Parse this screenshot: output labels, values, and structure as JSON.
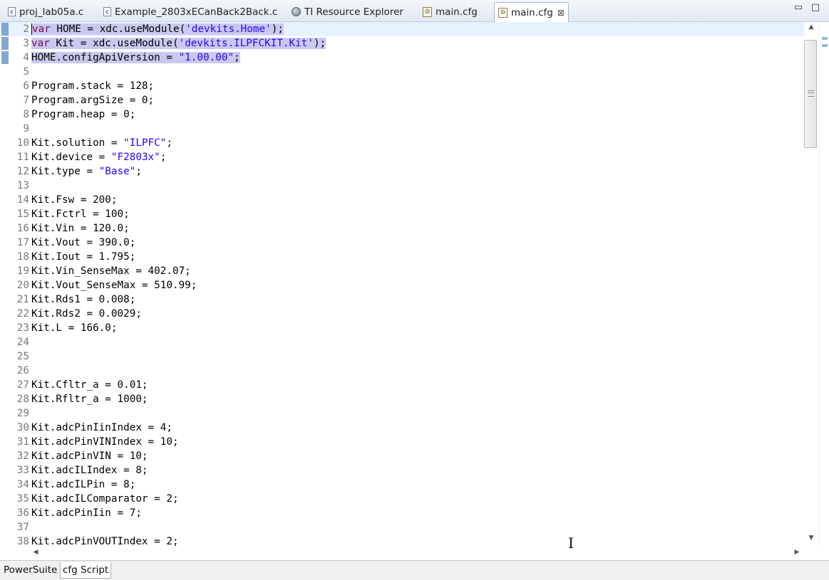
{
  "tabs": [
    {
      "label": "proj_lab05a.c",
      "icon": "c-file-icon"
    },
    {
      "label": "Example_2803xECanBack2Back.c",
      "icon": "c-file-icon"
    },
    {
      "label": "TI Resource Explorer",
      "icon": "globe-icon"
    },
    {
      "label": "main.cfg",
      "icon": "cfg-file-icon"
    },
    {
      "label": "main.cfg",
      "icon": "cfg-file-icon",
      "active": true,
      "close": "⊠"
    }
  ],
  "window_controls": {
    "minimize": "▭",
    "maximize": "□"
  },
  "code_lines": [
    {
      "n": "2",
      "parts": [
        [
          "kw",
          "var"
        ],
        [
          "t",
          " HOME = xdc.useModule("
        ],
        [
          "str",
          "'devkits.Home'"
        ],
        [
          "t",
          ");"
        ]
      ]
    },
    {
      "n": "3",
      "parts": [
        [
          "kw",
          "var"
        ],
        [
          "t",
          " Kit = xdc.useModule("
        ],
        [
          "str",
          "'devkits.ILPFCKIT.Kit'"
        ],
        [
          "t",
          ");"
        ]
      ]
    },
    {
      "n": "4",
      "parts": [
        [
          "t",
          "HOME.configApiVersion = "
        ],
        [
          "str",
          "\"1.00.00\""
        ],
        [
          "t",
          ";"
        ]
      ]
    },
    {
      "n": "5",
      "parts": []
    },
    {
      "n": "6",
      "parts": [
        [
          "t",
          "Program.stack = 128;"
        ]
      ]
    },
    {
      "n": "7",
      "parts": [
        [
          "t",
          "Program.argSize = 0;"
        ]
      ]
    },
    {
      "n": "8",
      "parts": [
        [
          "t",
          "Program.heap = 0;"
        ]
      ]
    },
    {
      "n": "9",
      "parts": []
    },
    {
      "n": "10",
      "parts": [
        [
          "t",
          "Kit.solution = "
        ],
        [
          "str",
          "\"ILPFC\""
        ],
        [
          "t",
          ";"
        ]
      ]
    },
    {
      "n": "11",
      "parts": [
        [
          "t",
          "Kit.device = "
        ],
        [
          "str",
          "\"F2803x\""
        ],
        [
          "t",
          ";"
        ]
      ]
    },
    {
      "n": "12",
      "parts": [
        [
          "t",
          "Kit.type = "
        ],
        [
          "str",
          "\"Base\""
        ],
        [
          "t",
          ";"
        ]
      ]
    },
    {
      "n": "13",
      "parts": []
    },
    {
      "n": "14",
      "parts": [
        [
          "t",
          "Kit.Fsw = 200;"
        ]
      ]
    },
    {
      "n": "15",
      "parts": [
        [
          "t",
          "Kit.Fctrl = 100;"
        ]
      ]
    },
    {
      "n": "16",
      "parts": [
        [
          "t",
          "Kit.Vin = 120.0;"
        ]
      ]
    },
    {
      "n": "17",
      "parts": [
        [
          "t",
          "Kit.Vout = 390.0;"
        ]
      ]
    },
    {
      "n": "18",
      "parts": [
        [
          "t",
          "Kit.Iout = 1.795;"
        ]
      ]
    },
    {
      "n": "19",
      "parts": [
        [
          "t",
          "Kit.Vin_SenseMax = 402.07;"
        ]
      ]
    },
    {
      "n": "20",
      "parts": [
        [
          "t",
          "Kit.Vout_SenseMax = 510.99;"
        ]
      ]
    },
    {
      "n": "21",
      "parts": [
        [
          "t",
          "Kit.Rds1 = 0.008;"
        ]
      ]
    },
    {
      "n": "22",
      "parts": [
        [
          "t",
          "Kit.Rds2 = 0.0029;"
        ]
      ]
    },
    {
      "n": "23",
      "parts": [
        [
          "t",
          "Kit.L = 166.0;"
        ]
      ]
    },
    {
      "n": "24",
      "parts": []
    },
    {
      "n": "25",
      "parts": []
    },
    {
      "n": "26",
      "parts": []
    },
    {
      "n": "27",
      "parts": [
        [
          "t",
          "Kit.Cfltr_a = 0.01;"
        ]
      ]
    },
    {
      "n": "28",
      "parts": [
        [
          "t",
          "Kit.Rfltr_a = 1000;"
        ]
      ]
    },
    {
      "n": "29",
      "parts": []
    },
    {
      "n": "30",
      "parts": [
        [
          "t",
          "Kit.adcPinIinIndex = 4;"
        ]
      ]
    },
    {
      "n": "31",
      "parts": [
        [
          "t",
          "Kit.adcPinVINIndex = 10;"
        ]
      ]
    },
    {
      "n": "32",
      "parts": [
        [
          "t",
          "Kit.adcPinVIN = 10;"
        ]
      ]
    },
    {
      "n": "33",
      "parts": [
        [
          "t",
          "Kit.adcILIndex = 8;"
        ]
      ]
    },
    {
      "n": "34",
      "parts": [
        [
          "t",
          "Kit.adcILPin = 8;"
        ]
      ]
    },
    {
      "n": "35",
      "parts": [
        [
          "t",
          "Kit.adcILComparator = 2;"
        ]
      ]
    },
    {
      "n": "36",
      "parts": [
        [
          "t",
          "Kit.adcPinIin = 7;"
        ]
      ]
    },
    {
      "n": "37",
      "parts": []
    },
    {
      "n": "38",
      "parts": [
        [
          "t",
          "Kit.adcPinVOUTIndex = 2;"
        ]
      ]
    }
  ],
  "highlighted_lines": [
    "2",
    "3",
    "4"
  ],
  "current_line": "2",
  "bottom_tabs": [
    {
      "label": "PowerSuite",
      "active": false
    },
    {
      "label": "cfg Script",
      "active": true
    }
  ],
  "colors": {
    "keyword": "#7f0055",
    "string": "#2a00ff",
    "selection": "#c9c9ef",
    "current_line": "#e8f2fe"
  }
}
